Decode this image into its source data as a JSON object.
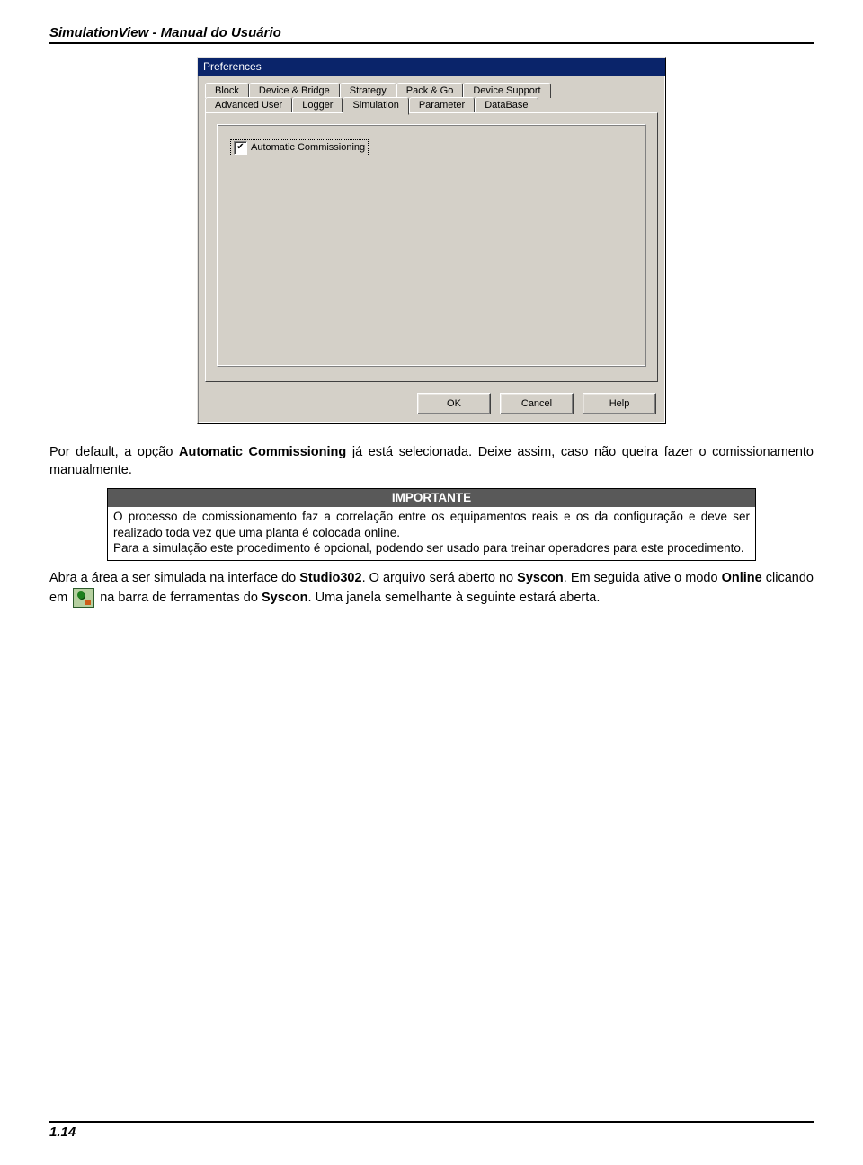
{
  "header": {
    "title": "SimulationView - Manual do Usuário"
  },
  "dialog": {
    "title": "Preferences",
    "tabs_row1": [
      "Block",
      "Device & Bridge",
      "Strategy",
      "Pack & Go",
      "Device Support"
    ],
    "tabs_row2": [
      "Advanced User",
      "Logger",
      "Simulation",
      "Parameter",
      "DataBase"
    ],
    "active_tab": "Simulation",
    "checkbox_label": "Automatic Commissioning",
    "buttons": {
      "ok": "OK",
      "cancel": "Cancel",
      "help": "Help"
    }
  },
  "paragraphs": {
    "p1_a": "Por default, a opção ",
    "p1_b": "Automatic Commissioning",
    "p1_c": " já está selecionada. Deixe assim, caso não queira fazer o comissionamento manualmente.",
    "important_title": "IMPORTANTE",
    "important_body_1": "O processo de comissionamento faz a correlação entre os equipamentos reais e os da configuração e deve ser realizado toda vez que uma planta é colocada online.",
    "important_body_2": "Para a simulação este procedimento é opcional, podendo ser usado para treinar operadores para este procedimento.",
    "p2_a": "Abra a área a ser simulada na interface do ",
    "p2_b": "Studio302",
    "p2_c": ". O arquivo será aberto no ",
    "p2_d": "Syscon",
    "p2_e": ". Em seguida ative o modo ",
    "p2_f": "Online",
    "p2_g": " clicando em ",
    "p2_h": " na barra de ferramentas do ",
    "p2_i": "Syscon",
    "p2_j": ". Uma janela semelhante à seguinte estará aberta."
  },
  "footer": {
    "page": "1.14"
  }
}
